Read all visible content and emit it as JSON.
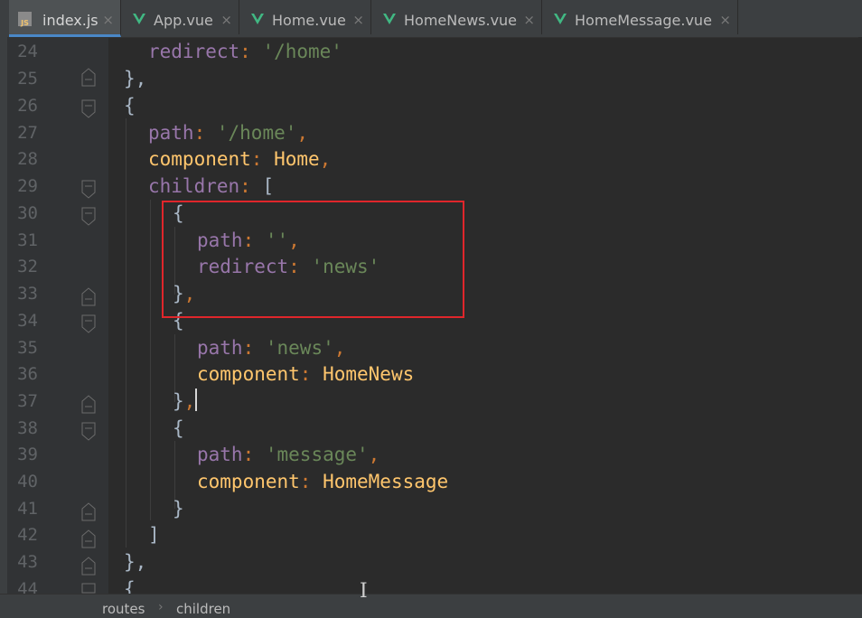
{
  "tabs": [
    {
      "label": "index.js",
      "icon": "js-file-icon",
      "close": "×"
    },
    {
      "label": "App.vue",
      "icon": "vue-file-icon",
      "close": "×"
    },
    {
      "label": "Home.vue",
      "icon": "vue-file-icon",
      "close": "×"
    },
    {
      "label": "HomeNews.vue",
      "icon": "vue-file-icon",
      "close": "×"
    },
    {
      "label": "HomeMessage.vue",
      "icon": "vue-file-icon",
      "close": "×"
    }
  ],
  "js_icon_text": "JS",
  "line_numbers": [
    "24",
    "25",
    "26",
    "27",
    "28",
    "29",
    "30",
    "31",
    "32",
    "33",
    "34",
    "35",
    "36",
    "37",
    "38",
    "39",
    "40",
    "41",
    "42",
    "43",
    "44"
  ],
  "code": {
    "l24": {
      "key": "redirect",
      "colon": ": ",
      "str": "'/home'"
    },
    "l25": {
      "text": "},"
    },
    "l26": {
      "text": "{"
    },
    "l27": {
      "key": "path",
      "colon": ": ",
      "str": "'/home'",
      "comma": ","
    },
    "l28": {
      "key": "component",
      "colon": ": ",
      "ident": "Home",
      "comma": ","
    },
    "l29": {
      "key": "children",
      "colon": ": ",
      "bracket": "["
    },
    "l30": {
      "text": "{"
    },
    "l31": {
      "key": "path",
      "colon": ": ",
      "str": "''",
      "comma": ","
    },
    "l32": {
      "key": "redirect",
      "colon": ": ",
      "str": "'news'"
    },
    "l33": {
      "text": "}",
      "comma": ","
    },
    "l34": {
      "text": "{"
    },
    "l35": {
      "key": "path",
      "colon": ": ",
      "str": "'news'",
      "comma": ","
    },
    "l36": {
      "key": "component",
      "colon": ": ",
      "ident": "HomeNews"
    },
    "l37": {
      "text": "}",
      "comma": ","
    },
    "l38": {
      "text": "{"
    },
    "l39": {
      "key": "path",
      "colon": ": ",
      "str": "'message'",
      "comma": ","
    },
    "l40": {
      "key": "component",
      "colon": ": ",
      "ident": "HomeMessage"
    },
    "l41": {
      "text": "}"
    },
    "l42": {
      "text": "]"
    },
    "l43": {
      "text": "},"
    },
    "l44": {
      "text": "{"
    }
  },
  "breadcrumb": {
    "first": "routes",
    "separator": "›",
    "second": "children"
  },
  "colors": {
    "background": "#2b2b2b",
    "keyword_purple": "#9876aa",
    "string_green": "#6a8759",
    "punctuation_orange": "#cc7832",
    "identifier_yellow": "#ffc66d",
    "highlight_box": "#e0262b"
  }
}
